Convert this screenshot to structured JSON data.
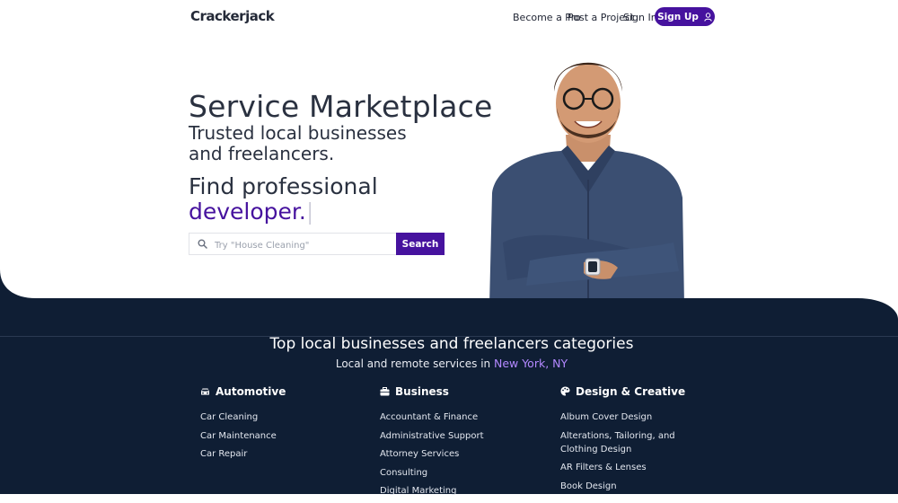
{
  "brand": {
    "logo": "Crackerjack"
  },
  "nav": {
    "become_pro": "Become a Pro",
    "post_project": "Post a Project",
    "sign_in": "Sign In",
    "sign_up": "Sign Up"
  },
  "hero": {
    "title": "Service Marketplace",
    "subtitle": "Trusted local businesses and freelancers.",
    "find_prefix": "Find professional",
    "find_keyword": "developer.",
    "cursor": "|"
  },
  "search": {
    "placeholder": "Try \"House Cleaning\"",
    "value": "",
    "button": "Search"
  },
  "categories": {
    "title": "Top local businesses and freelancers categories",
    "subtitle_prefix": "Local and remote services in",
    "location": "New York, NY",
    "columns": [
      {
        "icon": "car-icon",
        "name": "Automotive",
        "items": [
          "Car Cleaning",
          "Car Maintenance",
          "Car Repair"
        ]
      },
      {
        "icon": "briefcase-icon",
        "name": "Business",
        "items": [
          "Accountant & Finance",
          "Administrative Support",
          "Attorney Services",
          "Consulting",
          "Digital Marketing"
        ]
      },
      {
        "icon": "palette-icon",
        "name": "Design & Creative",
        "items": [
          "Album Cover Design",
          "Alterations, Tailoring, and Clothing Design",
          "AR Filters & Lenses",
          "Book Design"
        ]
      }
    ]
  },
  "colors": {
    "brand": "#46129e",
    "dark": "#0f1e34",
    "accent_light": "#b388ff"
  }
}
